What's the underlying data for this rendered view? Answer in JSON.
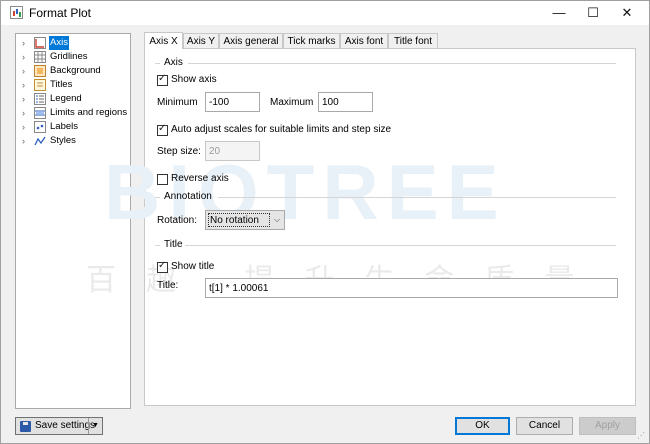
{
  "window": {
    "title": "Format Plot",
    "minimize_icon": "minimize-icon",
    "maximize_icon": "maximize-icon",
    "close_icon": "close-icon"
  },
  "tree": {
    "items": [
      {
        "label": "Axis",
        "icon": "axis-icon",
        "selected": true
      },
      {
        "label": "Gridlines",
        "icon": "gridlines-icon"
      },
      {
        "label": "Background",
        "icon": "background-icon"
      },
      {
        "label": "Titles",
        "icon": "titles-icon"
      },
      {
        "label": "Legend",
        "icon": "legend-icon"
      },
      {
        "label": "Limits and regions",
        "icon": "limits-icon"
      },
      {
        "label": "Labels",
        "icon": "labels-icon"
      },
      {
        "label": "Styles",
        "icon": "styles-icon"
      }
    ]
  },
  "tabs": [
    {
      "label": "Axis X",
      "active": true
    },
    {
      "label": "Axis Y"
    },
    {
      "label": "Axis general"
    },
    {
      "label": "Tick marks"
    },
    {
      "label": "Axis font"
    },
    {
      "label": "Title font"
    }
  ],
  "axis_group": {
    "title": "Axis",
    "show_axis_label": "Show axis",
    "show_axis_checked": true,
    "minimum_label": "Minimum",
    "minimum_value": "-100",
    "maximum_label": "Maximum",
    "maximum_value": "100",
    "auto_adjust_label": "Auto adjust scales for suitable limits and step size",
    "auto_adjust_checked": true,
    "step_size_label": "Step size:",
    "step_size_value": "20",
    "reverse_axis_label": "Reverse axis",
    "reverse_axis_checked": false
  },
  "annotation_group": {
    "title": "Annotation",
    "rotation_label": "Rotation:",
    "rotation_value": "No rotation"
  },
  "title_group": {
    "title": "Title",
    "show_title_label": "Show title",
    "show_title_checked": true,
    "title_label": "Title:",
    "title_value": "t[1] * 1.00061"
  },
  "footer": {
    "save_settings_label": "Save settings",
    "ok_label": "OK",
    "cancel_label": "Cancel",
    "apply_label": "Apply"
  },
  "watermark": {
    "text": "BIOTREE",
    "subtext": "百趣 提升生命质量"
  },
  "colors": {
    "accent": "#0078d7",
    "panel_bg": "#ffffff",
    "window_bg": "#f0f0f0"
  }
}
